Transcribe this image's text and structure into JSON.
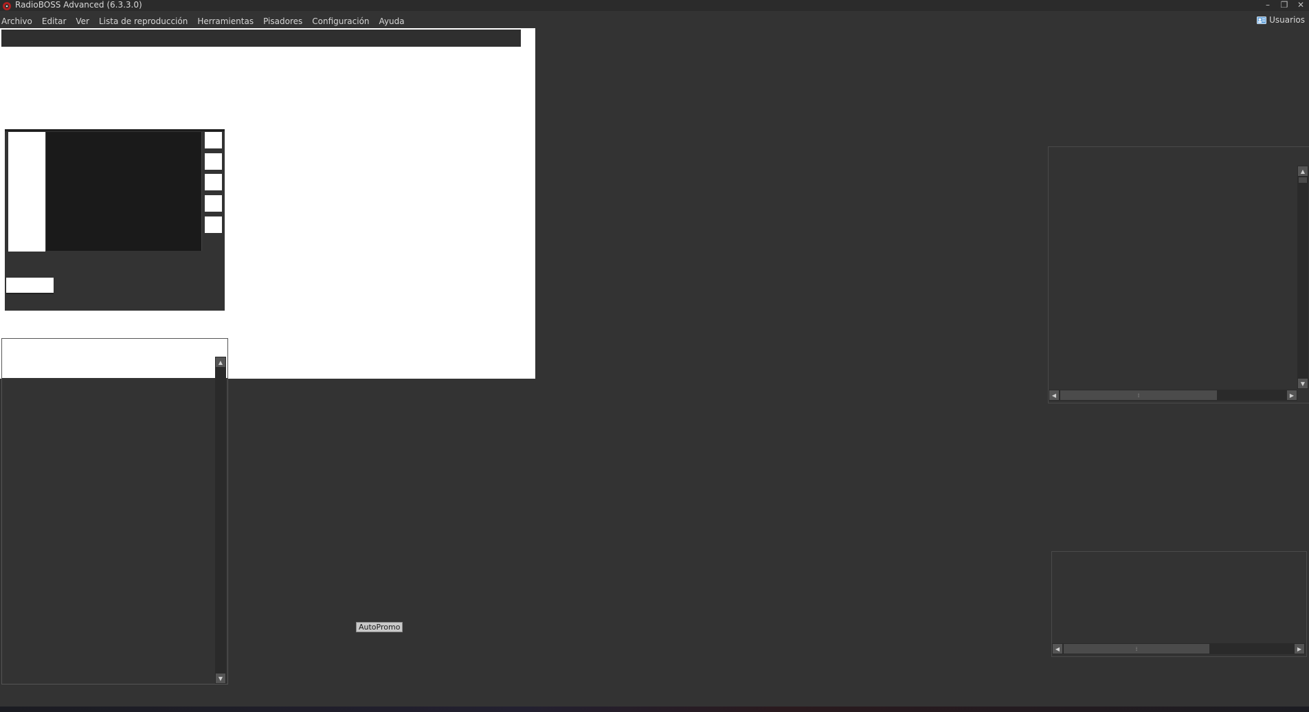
{
  "window": {
    "title": "RadioBOSS Advanced (6.3.3.0)",
    "controls": [
      "–",
      "❐",
      "✕"
    ]
  },
  "menu": {
    "items": [
      "Archivo",
      "Editar",
      "Ver",
      "Lista de reproducción",
      "Herramientas",
      "Pisadores",
      "Configuración",
      "Ayuda"
    ]
  },
  "users": {
    "label": "Usuarios"
  },
  "autopromo": {
    "label": "AutoPromo"
  },
  "icons": {
    "app": "radioboss-app-icon",
    "users": "users-card-icon"
  },
  "colors": {
    "background": "#333333",
    "panel_white": "#ffffff",
    "dark_panel": "#1a1a1a"
  }
}
